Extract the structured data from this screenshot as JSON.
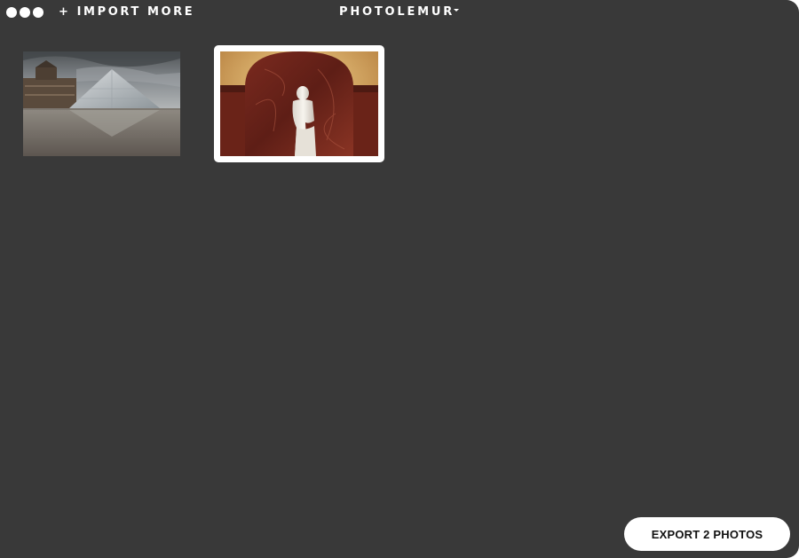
{
  "header": {
    "import_label": "+ IMPORT MORE",
    "app_title": "PHOTOLEMUR"
  },
  "photos": [
    {
      "name": "louvre-pyramid",
      "selected": false
    },
    {
      "name": "venus-de-milo",
      "selected": true
    }
  ],
  "footer": {
    "export_label": "EXPORT 2 PHOTOS"
  },
  "colors": {
    "background": "#393939",
    "text": "#ffffff",
    "button_bg": "#ffffff",
    "button_text": "#111111"
  }
}
